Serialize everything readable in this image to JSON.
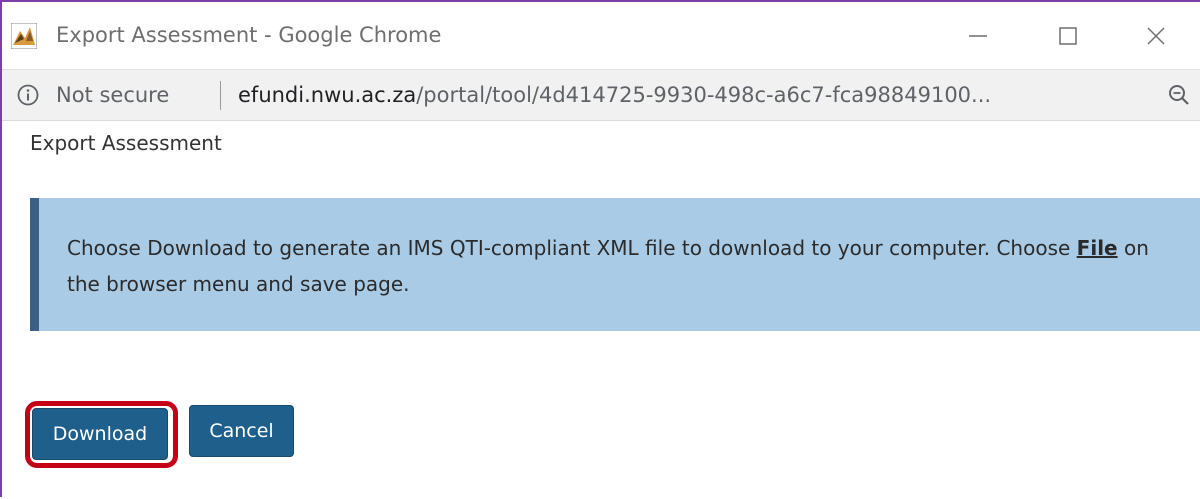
{
  "window": {
    "title": "Export Assessment - Google Chrome",
    "icon": "sakai-logo-icon",
    "controls": {
      "minimize_icon": "minimize-icon",
      "maximize_icon": "maximize-icon",
      "close_icon": "close-icon"
    }
  },
  "addressbar": {
    "security_icon": "info-icon",
    "security_label": "Not secure",
    "url_domain": "efundi.nwu.ac.za",
    "url_path": "/portal/tool/4d414725-9930-498c-a6c7-fca98849100...",
    "zoom_icon": "zoom-icon"
  },
  "page": {
    "heading": "Export Assessment",
    "info": {
      "text_before": "Choose Download to generate an IMS QTI-compliant XML file to download to your computer. Choose ",
      "file_word": "File",
      "text_after": " on the browser menu and save page."
    },
    "buttons": {
      "download_label": "Download",
      "cancel_label": "Cancel"
    }
  },
  "colors": {
    "window_border": "#7b3fa6",
    "info_bg": "#a9cbe6",
    "info_accent": "#3b5f86",
    "button_bg": "#1f5f8b",
    "highlight": "#c40017"
  }
}
